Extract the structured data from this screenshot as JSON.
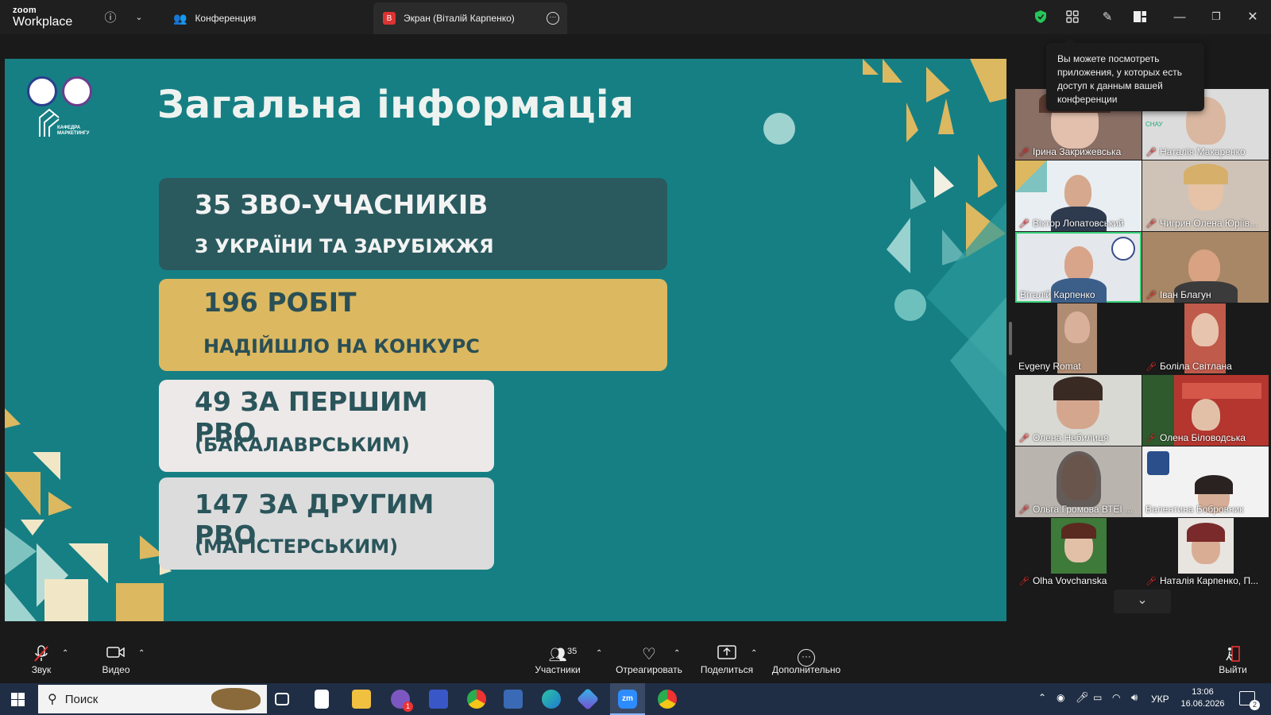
{
  "app": {
    "brand_small": "zoom",
    "brand": "Workplace"
  },
  "tabs": [
    {
      "label": "Конференция"
    },
    {
      "label": "Экран (Віталій Карпенко)",
      "badge": "В"
    }
  ],
  "tooltip": "Вы можете посмотреть приложения, у которых есть доступ к данным вашей конференции",
  "slide": {
    "title": "Загальна інформація",
    "logo_text": "КАФЕДРА\nМАРКЕТИНГУ",
    "cards": [
      {
        "line1": "35 ЗВО-УЧАСНИКІВ",
        "line2": "З УКРАЇНИ ТА ЗАРУБІЖЖЯ"
      },
      {
        "line1": "196 РОБІТ",
        "line2": "НАДІЙШЛО НА КОНКУРС"
      },
      {
        "line1": "49 ЗА ПЕРШИМ РВО",
        "line2": "(БАКАЛАВРСЬКИМ)"
      },
      {
        "line1": "147 ЗА ДРУГИМ РВО",
        "line2": "(МАГІСТЕРСЬКИМ)"
      }
    ]
  },
  "participants": [
    {
      "name": "Ірина Закрижевська",
      "muted": true
    },
    {
      "name": "Наталія Макаренко",
      "muted": true
    },
    {
      "name": "Віктор Лопатовський",
      "muted": true
    },
    {
      "name": "Чигрин Олена Юріїв...",
      "muted": true
    },
    {
      "name": "Віталій Карпенко",
      "muted": false
    },
    {
      "name": "Іван Благун",
      "muted": true
    },
    {
      "name": "Evgeny Romat",
      "muted": false
    },
    {
      "name": "Боліла  Світлана",
      "muted": true
    },
    {
      "name": "Олена Небилиця",
      "muted": true
    },
    {
      "name": "Олена Біловодська",
      "muted": true
    },
    {
      "name": "Ольга Громова ВТЕІ ...",
      "muted": true
    },
    {
      "name": "Валентина Бобровник",
      "muted": false
    },
    {
      "name": "Olha Vovchanska",
      "muted": true
    },
    {
      "name": "Наталія Карпенко, П...",
      "muted": true
    }
  ],
  "toolbar": {
    "audio": "Звук",
    "video": "Видео",
    "participants": "Участники",
    "participants_count": "35",
    "react": "Отреагировать",
    "share": "Поделиться",
    "more": "Дополнительно",
    "leave": "Выйти"
  },
  "taskbar": {
    "search": "Поиск",
    "lang": "УКР",
    "time": "13:06",
    "date": "16.06.2026",
    "notif": "2",
    "viber_badge": "1"
  },
  "colors": {
    "slide_bg": "#167f84",
    "gold": "#dcb860",
    "dark_card": "#2a5a5e",
    "active_speaker": "#3ad17a"
  }
}
